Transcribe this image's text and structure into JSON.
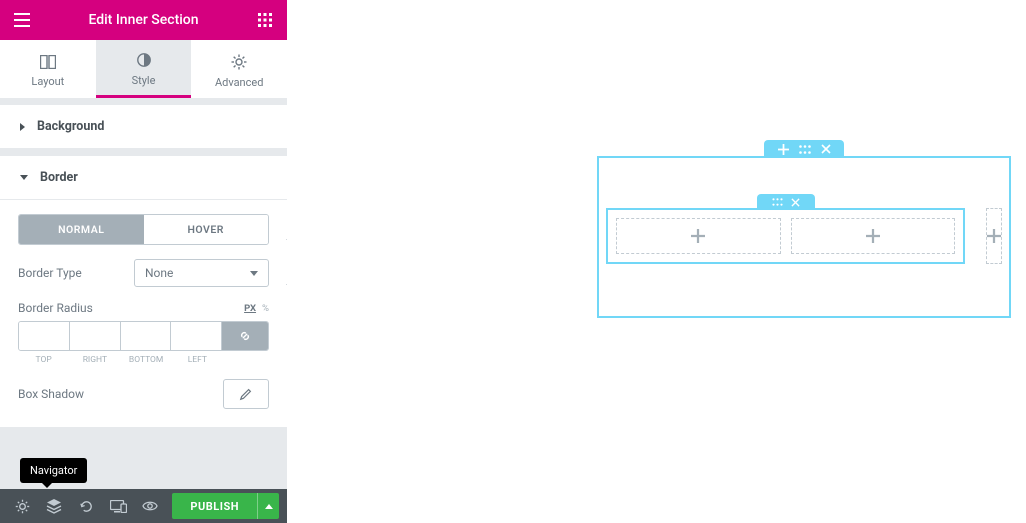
{
  "header": {
    "title": "Edit Inner Section"
  },
  "tabs": {
    "layout": "Layout",
    "style": "Style",
    "advanced": "Advanced"
  },
  "sections": {
    "background": "Background",
    "border": "Border"
  },
  "border": {
    "normal": "NORMAL",
    "hover": "HOVER",
    "type_label": "Border Type",
    "type_value": "None",
    "radius_label": "Border Radius",
    "unit_px": "PX",
    "unit_pct": "%",
    "sides": {
      "top": "TOP",
      "right": "RIGHT",
      "bottom": "BOTTOM",
      "left": "LEFT"
    },
    "box_shadow_label": "Box Shadow"
  },
  "footer": {
    "tooltip": "Navigator",
    "publish": "PUBLISH"
  },
  "icons": {
    "burger": "menu-icon",
    "apps": "apps-icon",
    "layout": "layout-icon",
    "style": "style-icon",
    "advanced": "gear-icon",
    "link": "link-icon",
    "pencil": "pencil-icon",
    "settings": "gear-icon",
    "navigator": "layers-icon",
    "history": "history-icon",
    "responsive": "responsive-icon",
    "preview": "eye-icon",
    "plus": "plus-icon",
    "grip": "grip-icon",
    "close": "close-icon"
  }
}
